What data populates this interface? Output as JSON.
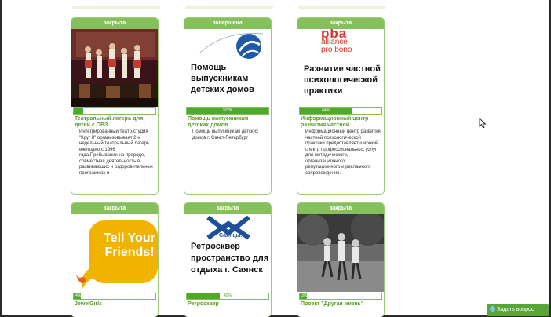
{
  "cards": [
    {
      "status": "закрыта",
      "percent": "12%",
      "progress_fraction": 0.12,
      "title": "Театральный лагерь для детей с ОВЗ",
      "description": "Интегрированный театр-студия \"Круг II\" организовывает 2-х недельный театральный лагерь ежегодно с 1996 года.Пребывание на природе, совместная деятельность в развивающих и оздоровительных программах и"
    },
    {
      "status": "завершена",
      "percent": "102%",
      "progress_fraction": 1.0,
      "image_text": "Помощь выпускникам детских домов",
      "title": "Помощь выпускникам детских домов",
      "description": "Помощь выпускникам детских домов г. Санкт-Петербург"
    },
    {
      "status": "закрыта",
      "percent": "64%",
      "progress_fraction": 0.64,
      "logo_text_1": "alliance",
      "logo_text_2": "pro bono",
      "image_text": "Развитие частной психологической практики",
      "title": "Информационный центр развития частной",
      "description": "Информационный центр развития частной психологической практики предоставляет широкий спектр профессиональных услуг для методического, организационного, репутационного и рекламного сопровождения."
    },
    {
      "status": "закрыта",
      "percent": "4%",
      "progress_fraction": 0.04,
      "image_text": "Tell Your Friends!",
      "title": "JewelGirls"
    },
    {
      "status": "закрыта",
      "percent": "40%",
      "progress_fraction": 0.4,
      "logo_text": "Саянцы.ру",
      "image_text": "Ретросквер пространство для отдыха г. Саянск",
      "title": "Ретросквер"
    },
    {
      "status": "закрыта",
      "percent": "3%",
      "progress_fraction": 0.03,
      "title": "Проект \"Другая жизнь\""
    }
  ],
  "chat_button": {
    "label": "Задать вопрос"
  },
  "colors": {
    "accent": "#86c05c",
    "progress": "#4fa92a",
    "title": "#5a9b2c"
  }
}
